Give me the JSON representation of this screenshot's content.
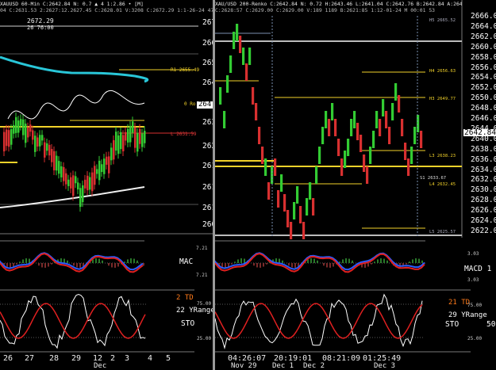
{
  "colors": {
    "background": "#000000",
    "candle_up": "#33cc33",
    "candle_down": "#d83030",
    "level_yellow": "#f2d22a",
    "ma_cyan": "#29c6d8",
    "ma_white": "#f0f0f0",
    "macd_red": "#e02020",
    "macd_blue": "#2a5cff",
    "stoch_white": "#ffffff",
    "stoch_red": "#e02020",
    "label_orange": "#ff7a1a",
    "grid_gray": "#5a5a5a"
  },
  "left_chart": {
    "header": "XAUUSD 60-Min C:2642.84 N: 0.7 ▲ 4 1:2.86 • [M]",
    "header2": "04 C:2631.53 2:2627:12.2627.45 C:2628.01 V:3208 C:2672.29 1:1-26-24 47:28",
    "price_label_top": "2672.29",
    "price_label_top2": "26 76:00",
    "pivot_r1": "R1 2655.49",
    "pivot_0": "0 Ro",
    "pivot_l": "L 2631.59",
    "y_axis_partial": [
      "267",
      "266",
      "265",
      "264",
      "264",
      "263",
      "262",
      "261",
      "261",
      "260"
    ],
    "price_marker": "264",
    "x_ticks": [
      "26",
      "27",
      "28",
      "29",
      "12",
      "2",
      "3",
      "4",
      "5"
    ],
    "x_month": "Dec",
    "macd_label": "MAC",
    "macd_ticks": [
      "7.21",
      "7.21"
    ],
    "stoch_td": "2 TD",
    "stoch_range": "22 YRange",
    "stoch_label": "STO",
    "stoch_ticks": [
      "75.00",
      "25.00"
    ]
  },
  "right_chart": {
    "header": "XAU/USD 200-Renko C:2642.84 N: 0.72 H:2643.46 L:2641.04 C:2642.76 B:2642.84 A:2643.16 V:1,495 OI:0",
    "header2": "C:2628:57 C:2629.00 C:2629.00 V:189 1189 B:2621:85 1:12-01-24 M 00:01 53",
    "y_axis": [
      "2666.00",
      "2664.00",
      "2662.00",
      "2660.00",
      "2658.00",
      "2656.00",
      "2654.00",
      "2652.00",
      "2650.00",
      "2648.00",
      "2646.00",
      "2644.00",
      "2642.84",
      "2640.00",
      "2638.00",
      "2636.00",
      "2634.00",
      "2632.00",
      "2630.00",
      "2628.00",
      "2626.00",
      "2624.00",
      "2622.00"
    ],
    "price_marker": "2642.84",
    "level_labels": {
      "h5": "H5 2665.52",
      "h4": "H4 2656.63",
      "h3": "H3 2649.77",
      "l3": "L3 2638.23",
      "s1": "S1 2633.67",
      "l4": "L4 2632.45",
      "l5": "L5 2625.57"
    },
    "x_ticks": [
      "04:26:07",
      "20:19:01",
      "08:21:09",
      "01:25:49"
    ],
    "x_dates": [
      "Nov 29",
      "Dec 1",
      "Dec 2",
      "Dec 3"
    ],
    "macd_label": "MACD 1",
    "macd_ticks": [
      "3.03",
      "3.03"
    ],
    "stoch_td": "21 TD",
    "stoch_range": "29 YRange",
    "stoch_label": "STO",
    "stoch_value": "50",
    "stoch_ticks": [
      "75.00",
      "50.00",
      "25.00"
    ]
  }
}
